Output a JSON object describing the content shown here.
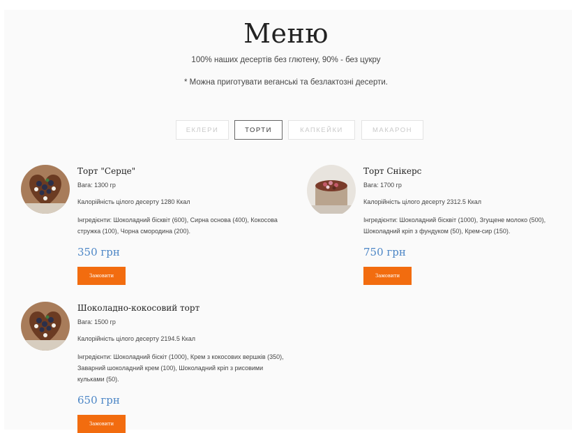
{
  "header": {
    "title": "Меню",
    "subtitle": "100% наших десертів без глютену, 90% - без цукру",
    "note": "* Можна приготувати веганські та безлактозні десерти."
  },
  "tabs": [
    {
      "label": "ЕКЛЕРИ",
      "active": false
    },
    {
      "label": "ТОРТИ",
      "active": true
    },
    {
      "label": "КАПКЕЙКИ",
      "active": false
    },
    {
      "label": "МАКАРОН",
      "active": false
    }
  ],
  "products": [
    {
      "name": "Торт \"Серце\"",
      "weight": "Вага: 1300 гр",
      "calories": "Калорійність цілого десерту 1280 Ккал",
      "ingredients": "Інгредієнти: Шоколадний бісквіт (600), Сирна основа (400), Кокосова стружка (100), Чорна смородина (200).",
      "price": "350 грн",
      "button": "Замовити",
      "image_icon": "heart-cake-icon"
    },
    {
      "name": "Торт Снікерс",
      "weight": "Вага: 1700 гр",
      "calories": "Калорійність цілого десерту 2312.5 Ккал",
      "ingredients": "Інгредієнти: Шоколадний бісквіт (1000), Згущене молоко (500), Шоколадний кріп з фундуком (50), Крем-сир (150).",
      "price": "750 грн",
      "button": "Замовити",
      "image_icon": "snickers-cake-icon"
    },
    {
      "name": "Шоколадно-кокосовий торт",
      "weight": "Вага: 1500 гр",
      "calories": "Калорійність цілого десерту 2194.5 Ккал",
      "ingredients": "Інгредієнти: Шоколадний біскіт (1000), Крем з кокосових вершків (350), Заварний шоколадний крем (100), Шоколадний кріп з рисовими кульками (50).",
      "price": "650 грн",
      "button": "Замовити",
      "image_icon": "chocolate-coconut-cake-icon"
    }
  ],
  "colors": {
    "accent_button": "#f26c0f",
    "price": "#4c86c6"
  }
}
